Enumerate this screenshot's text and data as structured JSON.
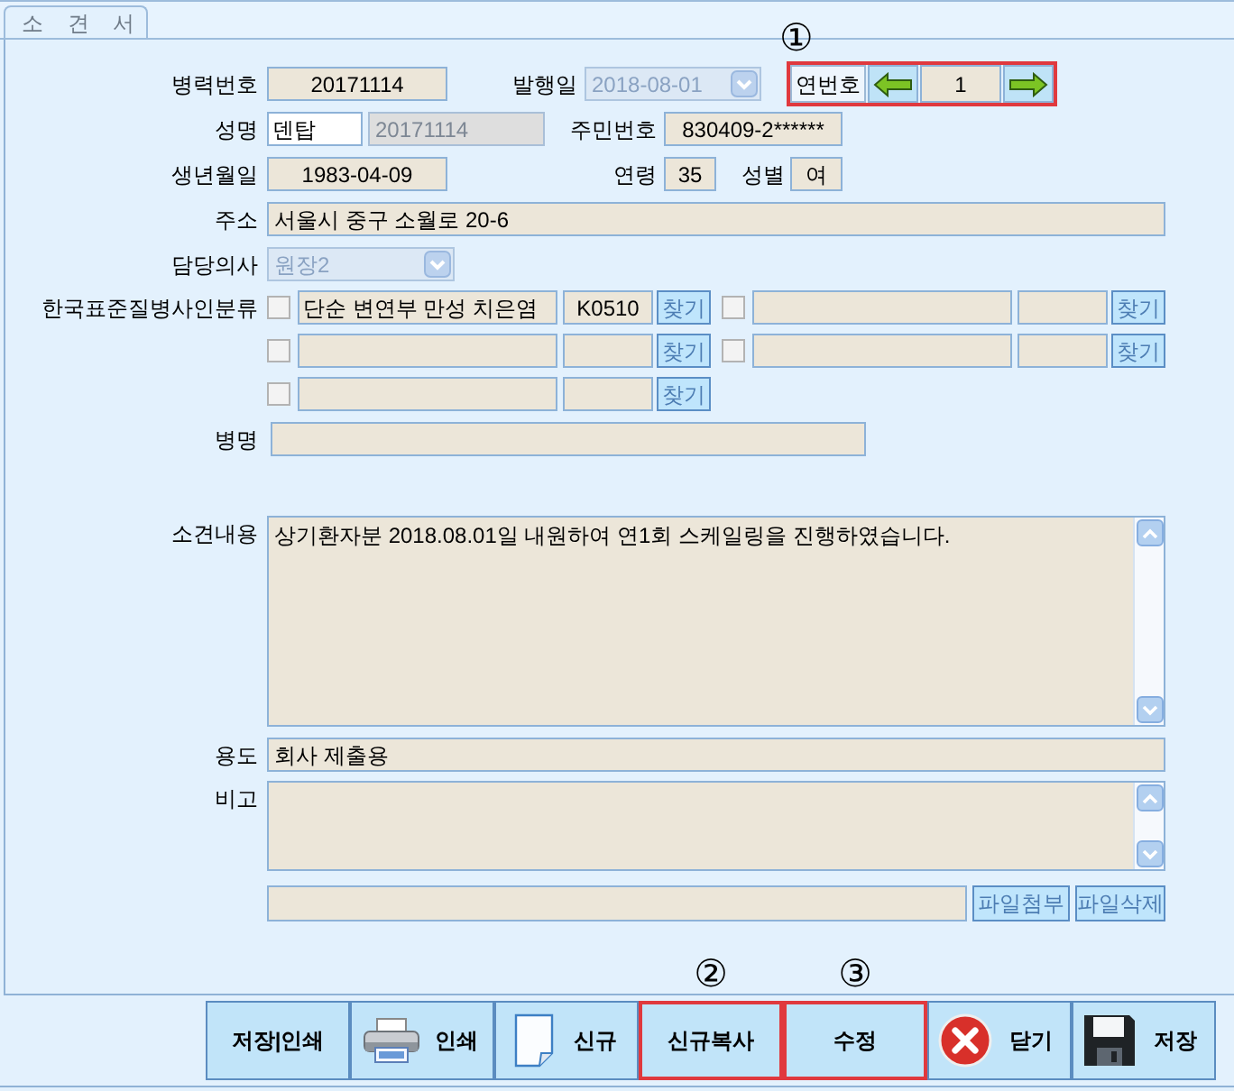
{
  "tabs": [
    {
      "label": "소 견 서",
      "selected": true
    }
  ],
  "record": {
    "label": "병력번호",
    "value": "20171114"
  },
  "issue_date": {
    "label": "발행일",
    "value": "2018-08-01",
    "disabled": true
  },
  "serial": {
    "label": "연번호",
    "value": "1",
    "callout": "①",
    "highlighted": true
  },
  "patient_name": {
    "label": "성명",
    "value": "덴탑",
    "chart_no": {
      "value": "20171114",
      "disabled": true
    }
  },
  "resident_no": {
    "label": "주민번호",
    "value": "830409-2******"
  },
  "birth_date": {
    "label": "생년월일",
    "value": "1983-04-09"
  },
  "age": {
    "label": "연령",
    "value": "35"
  },
  "sex": {
    "label": "성별",
    "value": "여"
  },
  "address": {
    "label": "주소",
    "value": "서울시 중구 소월로 20-6"
  },
  "doctor": {
    "label": "담당의사",
    "value": "원장2",
    "disabled": true
  },
  "disease_codes": {
    "label": "한국표준질병사인분류",
    "rows": [
      {
        "entries": [
          {
            "checked": false,
            "name": "단순 변연부 만성 치은염",
            "code": "K0510",
            "button": "찾기"
          },
          {
            "checked": false,
            "button": "찾기"
          }
        ]
      },
      {
        "entries": [
          {
            "checked": false,
            "button": "찾기"
          },
          {
            "checked": false,
            "button": "찾기"
          }
        ]
      },
      {
        "entries": [
          {
            "checked": false,
            "button": "찾기"
          }
        ]
      }
    ]
  },
  "diagnosis": {
    "label": "병명"
  },
  "findings": {
    "label": "소견내용",
    "value": "상기환자분 2018.08.01일 내원하여 연1회 스케일링을 진행하였습니다."
  },
  "purpose": {
    "label": "용도",
    "value": "회사 제출용"
  },
  "remarks": {
    "label": "비고"
  },
  "attachment": {
    "buttons": [
      "파일첨부",
      "파일삭제"
    ]
  },
  "toolbar": [
    {
      "label": "저장|인쇄",
      "kind": "text",
      "highlighted": false
    },
    {
      "label": "인쇄",
      "kind": "print",
      "highlighted": false
    },
    {
      "label": "신규",
      "kind": "new",
      "highlighted": false
    },
    {
      "label": "신규복사",
      "kind": "text",
      "highlighted": true,
      "callout": "②"
    },
    {
      "label": "수정",
      "kind": "text",
      "highlighted": true,
      "callout": "③"
    },
    {
      "label": "닫기",
      "kind": "close",
      "highlighted": false
    },
    {
      "label": "저장",
      "kind": "save",
      "highlighted": false
    }
  ]
}
